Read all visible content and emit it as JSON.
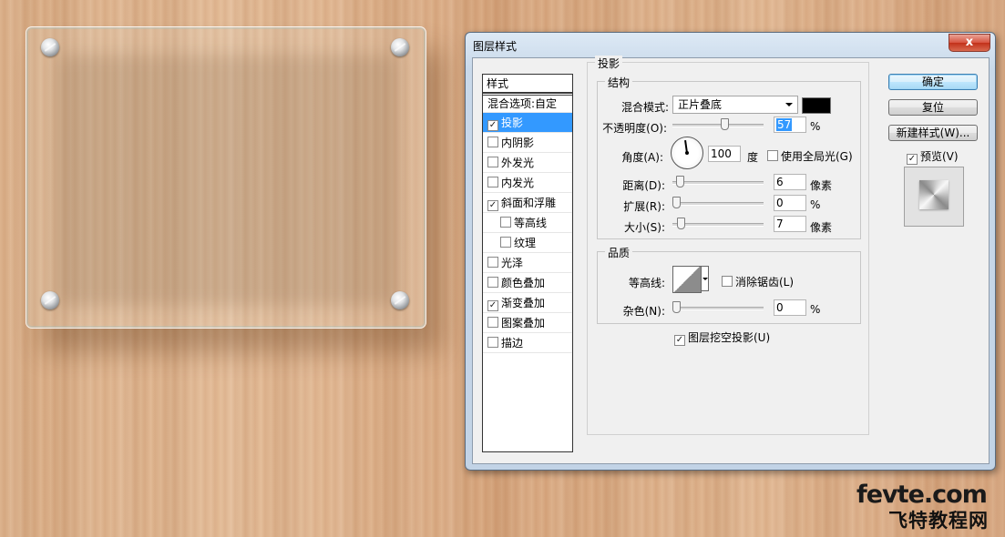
{
  "dialog": {
    "title": "图层样式",
    "close_glyph": "x"
  },
  "styles": {
    "header": "样式",
    "blend_options": "混合选项:自定",
    "items": [
      {
        "label": "投影",
        "checked": true,
        "selected": true
      },
      {
        "label": "内阴影",
        "checked": false
      },
      {
        "label": "外发光",
        "checked": false
      },
      {
        "label": "内发光",
        "checked": false
      },
      {
        "label": "斜面和浮雕",
        "checked": true
      },
      {
        "label": "等高线",
        "checked": false,
        "sub": true
      },
      {
        "label": "纹理",
        "checked": false,
        "sub": true
      },
      {
        "label": "光泽",
        "checked": false
      },
      {
        "label": "颜色叠加",
        "checked": false
      },
      {
        "label": "渐变叠加",
        "checked": true
      },
      {
        "label": "图案叠加",
        "checked": false
      },
      {
        "label": "描边",
        "checked": false
      }
    ]
  },
  "panel": {
    "title": "投影",
    "structure": {
      "title": "结构",
      "blend_mode_label": "混合模式:",
      "blend_mode_value": "正片叠底",
      "blend_color": "#000000",
      "opacity_label": "不透明度(O):",
      "opacity_value": "57",
      "opacity_unit": "%",
      "angle_label": "角度(A):",
      "angle_value": "100",
      "angle_unit": "度",
      "global_light_label": "使用全局光(G)",
      "global_light_checked": false,
      "distance_label": "距离(D):",
      "distance_value": "6",
      "distance_unit": "像素",
      "spread_label": "扩展(R):",
      "spread_value": "0",
      "spread_unit": "%",
      "size_label": "大小(S):",
      "size_value": "7",
      "size_unit": "像素"
    },
    "quality": {
      "title": "品质",
      "contour_label": "等高线:",
      "antialias_label": "消除锯齿(L)",
      "antialias_checked": false,
      "noise_label": "杂色(N):",
      "noise_value": "0",
      "noise_unit": "%"
    },
    "knockout_label": "图层挖空投影(U)",
    "knockout_checked": true
  },
  "buttons": {
    "ok": "确定",
    "reset": "复位",
    "new_style": "新建样式(W)...",
    "preview_label": "预览(V)",
    "preview_checked": true
  },
  "watermark": {
    "line1": "fevte.com",
    "line2": "飞特教程网"
  }
}
